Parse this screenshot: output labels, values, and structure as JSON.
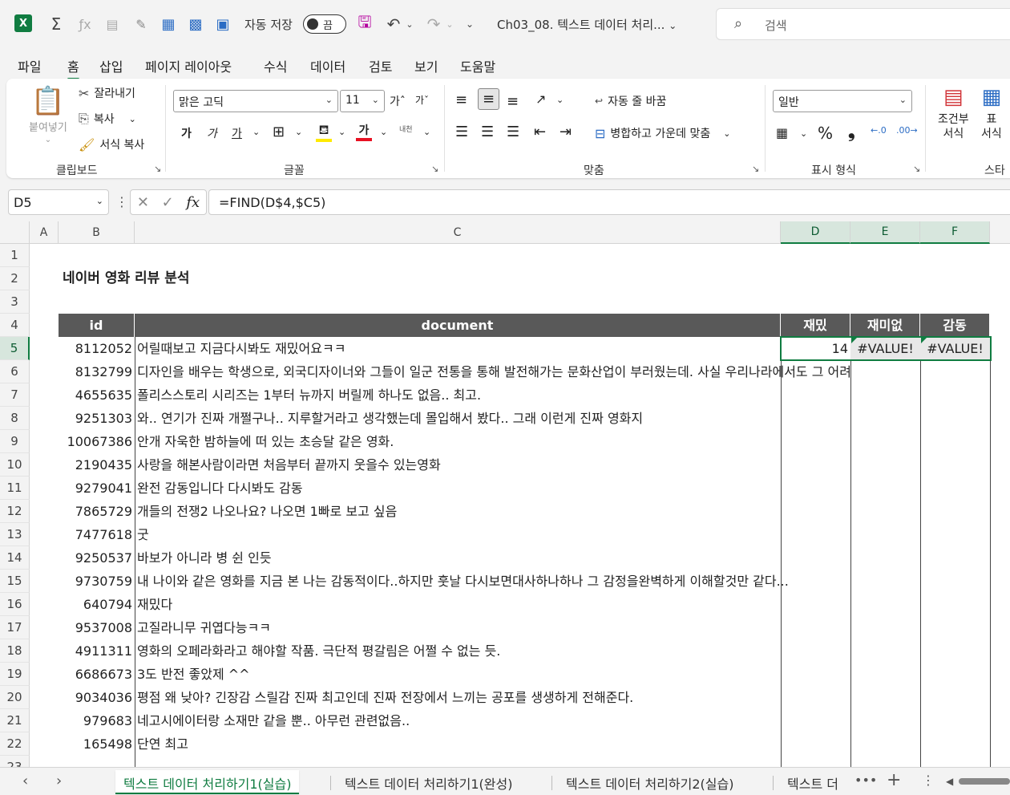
{
  "titlebar": {
    "app_icon": "X",
    "autosave_label": "자동 저장",
    "autosave_state": "끔",
    "doc_title": "Ch03_08. 텍스트 데이터 처리...",
    "search_placeholder": "검색"
  },
  "menu": [
    "파일",
    "홈",
    "삽입",
    "페이지 레이아웃",
    "수식",
    "데이터",
    "검토",
    "보기",
    "도움말"
  ],
  "ribbon": {
    "clipboard": {
      "paste": "붙여넣기",
      "cut": "잘라내기",
      "copy": "복사",
      "format_painter": "서식 복사",
      "label": "클립보드"
    },
    "font": {
      "name": "맑은 고딕",
      "size": "11",
      "grow": "가ˆ",
      "shrink": "가ˇ",
      "bold": "가",
      "italic": "가",
      "underline": "가",
      "phonetic": "내천",
      "label": "글꼴"
    },
    "alignment": {
      "wrap": "자동 줄 바꿈",
      "merge": "병합하고 가운데 맞춤",
      "label": "맞춤"
    },
    "number": {
      "format": "일반",
      "label": "표시 형식"
    },
    "styles": {
      "conditional": "조건부\n서식",
      "table": "표\n서식",
      "label": "스타"
    }
  },
  "formula_bar": {
    "name_box": "D5",
    "formula": "=FIND(D$4,$C5)"
  },
  "columns": [
    "A",
    "B",
    "C",
    "D",
    "E",
    "F"
  ],
  "sheet": {
    "title": "네이버 영화 리뷰 분석",
    "headers": {
      "id": "id",
      "document": "document",
      "d": "재밌",
      "e": "재미없",
      "f": "감동"
    },
    "d5": "14",
    "e5": "#VALUE!",
    "f5": "#VALUE!",
    "rows": [
      {
        "id": "8112052",
        "doc": "어릴때보고 지금다시봐도 재밌어요ㅋㅋ"
      },
      {
        "id": "8132799",
        "doc": "디자인을 배우는 학생으로, 외국디자이너와 그들이 일군 전통을 통해 발전해가는 문화산업이 부러웠는데. 사실 우리나라에서도 그 어려"
      },
      {
        "id": "4655635",
        "doc": "폴리스스토리 시리즈는 1부터 뉴까지 버릴께 하나도 없음.. 최고."
      },
      {
        "id": "9251303",
        "doc": "와.. 연기가 진짜 개쩔구나.. 지루할거라고 생각했는데 몰입해서 봤다.. 그래 이런게 진짜 영화지"
      },
      {
        "id": "10067386",
        "doc": "안개 자욱한 밤하늘에 떠 있는 초승달 같은 영화."
      },
      {
        "id": "2190435",
        "doc": "사랑을 해본사람이라면 처음부터 끝까지 웃을수 있는영화"
      },
      {
        "id": "9279041",
        "doc": "완전 감동입니다 다시봐도 감동"
      },
      {
        "id": "7865729",
        "doc": "개들의 전쟁2 나오나요? 나오면 1빠로 보고 싶음"
      },
      {
        "id": "7477618",
        "doc": "굿"
      },
      {
        "id": "9250537",
        "doc": "바보가 아니라 병 쉰 인듯"
      },
      {
        "id": "9730759",
        "doc": "내 나이와 같은 영화를 지금 본 나는 감동적이다..하지만 훗날 다시보면대사하나하나 그 감정을완벽하게 이해할것만 같다..."
      },
      {
        "id": "640794",
        "doc": "재밌다"
      },
      {
        "id": "9537008",
        "doc": "고질라니무 귀엽다능ㅋㅋ"
      },
      {
        "id": "4911311",
        "doc": "영화의 오페라화라고 해야할 작품. 극단적 평갈림은 어쩔 수 없는 듯."
      },
      {
        "id": "6686673",
        "doc": "3도 반전 좋았제 ^^"
      },
      {
        "id": "9034036",
        "doc": "평점 왜 낮아? 긴장감 스릴감 진짜 최고인데 진짜 전장에서 느끼는 공포를 생생하게 전해준다."
      },
      {
        "id": "979683",
        "doc": "네고시에이터랑 소재만 같을 뿐.. 아무런 관련없음.."
      },
      {
        "id": "165498",
        "doc": "단연 최고"
      }
    ]
  },
  "sheet_tabs": [
    "텍스트 데이터 처리하기1(실습)",
    "텍스트 데이터 처리하기1(완성)",
    "텍스트 데이터 처리하기2(실습)",
    "텍스트 더"
  ],
  "colors": {
    "excel_green": "#107c41",
    "header_fill": "#595959"
  }
}
